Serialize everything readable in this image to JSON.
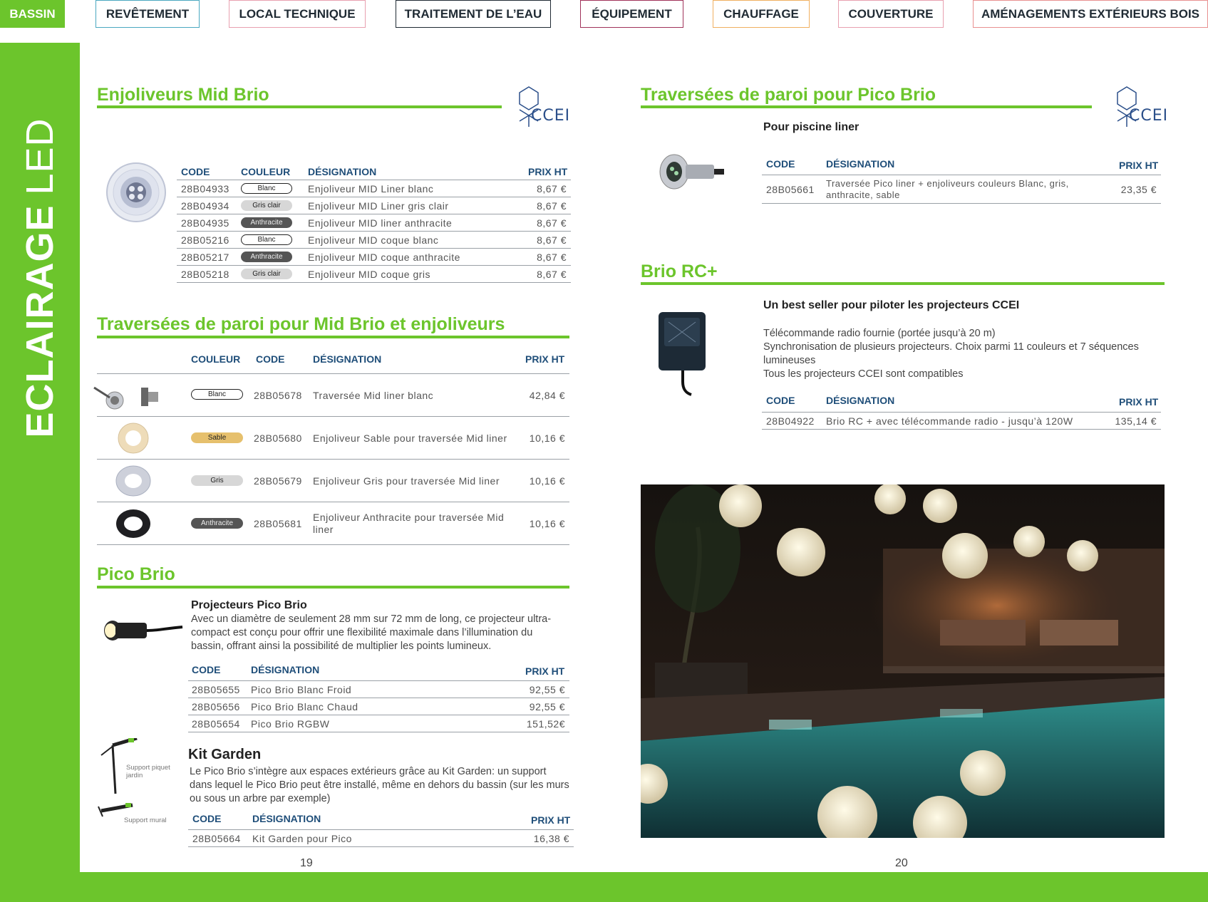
{
  "nav": {
    "tabs": [
      {
        "label": "BASSIN",
        "color": "#6cc52c",
        "active": true
      },
      {
        "label": "REVÊTEMENT",
        "color": "#4aa8c0"
      },
      {
        "label": "LOCAL TECHNIQUE",
        "color": "#e8a0b0"
      },
      {
        "label": "TRAITEMENT DE L’EAU",
        "color": "#1f2a33"
      },
      {
        "label": "ÉQUIPEMENT",
        "color": "#a0325a"
      },
      {
        "label": "CHAUFFAGE",
        "color": "#f0b060"
      },
      {
        "label": "COUVERTURE",
        "color": "#e8a0b0"
      },
      {
        "label": "AMÉNAGEMENTS EXTÉRIEURS BOIS",
        "color": "#e89090"
      }
    ]
  },
  "sidebar": {
    "title_bold": "ECLAIRAGE",
    "title_thin": "LED"
  },
  "brand": {
    "logo_text": "CCEI"
  },
  "headers": {
    "code": "CODE",
    "couleur": "COULEUR",
    "designation": "DÉSIGNATION",
    "prix": "PRIX HT"
  },
  "mid_brio": {
    "title": "Enjoliveurs Mid Brio",
    "rows": [
      {
        "code": "28B04933",
        "color": "Blanc",
        "designation": "Enjoliveur MID Liner blanc",
        "price": "8,67 €"
      },
      {
        "code": "28B04934",
        "color": "Gris clair",
        "designation": "Enjoliveur MID Liner gris clair",
        "price": "8,67 €"
      },
      {
        "code": "28B04935",
        "color": "Anthracite",
        "designation": "Enjoliveur MID liner anthracite",
        "price": "8,67 €"
      },
      {
        "code": "28B05216",
        "color": "Blanc",
        "designation": "Enjoliveur MID coque blanc",
        "price": "8,67 €"
      },
      {
        "code": "28B05217",
        "color": "Anthracite",
        "designation": "Enjoliveur MID coque anthracite",
        "price": "8,67 €"
      },
      {
        "code": "28B05218",
        "color": "Gris clair",
        "designation": "Enjoliveur MID coque gris",
        "price": "8,67 €"
      }
    ]
  },
  "traversees_mid": {
    "title": "Traversées de paroi pour Mid Brio et enjoliveurs",
    "rows": [
      {
        "color": "Blanc",
        "code": "28B05678",
        "designation": "Traversée Mid liner blanc",
        "designation2": "",
        "price": "42,84 €"
      },
      {
        "color": "Sable",
        "code": "28B05680",
        "designation": "Enjoliveur Sable pour traversée Mid liner",
        "designation2": "",
        "price": "10,16 €"
      },
      {
        "color": "Gris",
        "code": "28B05679",
        "designation": "Enjoliveur Gris pour traversée Mid liner",
        "designation2": "",
        "price": "10,16 €"
      },
      {
        "color": "Anthracite",
        "code": "28B05681",
        "designation": "Enjoliveur Anthracite pour traversée Mid",
        "designation2": "liner",
        "price": "10,16 €"
      }
    ]
  },
  "pico_brio": {
    "title": "Pico Brio",
    "subtitle": "Projecteurs Pico Brio",
    "text": [
      "Avec un diamètre de seulement 28 mm sur 72 mm de long, ce projecteur ultra-",
      "compact est conçu pour offrir une flexibilité maximale dans l’illumination du",
      "bassin, offrant ainsi la possibilité de multiplier les points lumineux."
    ],
    "rows": [
      {
        "code": "28B05655",
        "designation": "Pico Brio Blanc Froid",
        "price": "92,55 €"
      },
      {
        "code": "28B05656",
        "designation": "Pico Brio Blanc Chaud",
        "price": "92,55 €"
      },
      {
        "code": "28B05654",
        "designation": "Pico Brio RGBW",
        "price": "151,52€"
      }
    ]
  },
  "kit_garden": {
    "title": "Kit Garden",
    "text": [
      "Le Pico Brio s’intègre aux espaces extérieurs grâce au Kit Garden: un support",
      "dans lequel le Pico Brio peut être installé, même en dehors du bassin (sur les murs",
      "ou sous un arbre par exemple)"
    ],
    "caption_piquet": [
      "Support piquet",
      "jardin"
    ],
    "caption_mural": "Support mural",
    "rows": [
      {
        "code": "28B05664",
        "designation": "Kit Garden pour Pico",
        "price": "16,38 €"
      }
    ]
  },
  "traversees_pico": {
    "title": "Traversées de paroi pour Pico Brio",
    "subtitle": "Pour piscine liner",
    "rows": [
      {
        "code": "28B05661",
        "designation": "Traversée Pico liner + enjoliveurs couleurs Blanc, gris,",
        "designation2": "anthracite, sable",
        "price": "23,35 €"
      }
    ]
  },
  "brio_rc": {
    "title": "Brio RC+",
    "subtitle": "Un best seller pour piloter les projecteurs CCEI",
    "text": [
      "Télécommande radio fournie (portée jusqu’à 20 m)",
      "Synchronisation de plusieurs projecteurs. Choix parmi 11 couleurs et 7 séquences",
      "lumineuses",
      "Tous les projecteurs CCEI sont compatibles"
    ],
    "rows": [
      {
        "code": "28B04922",
        "designation": "Brio RC + avec télécommande radio - jusqu’à 120W",
        "price": "135,14 €"
      }
    ]
  },
  "pages": {
    "left": "19",
    "right": "20"
  }
}
